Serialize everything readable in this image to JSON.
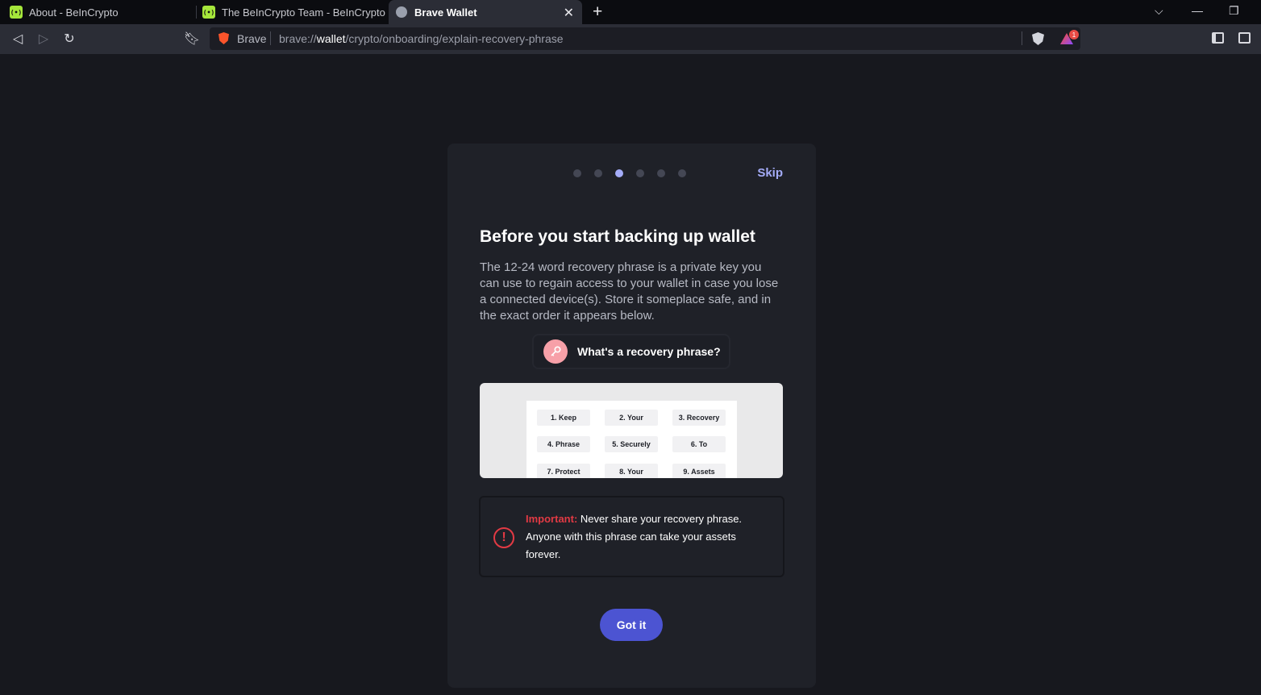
{
  "tabs": [
    {
      "title": "About - BeInCrypto",
      "favicon": "beincrypto-icon"
    },
    {
      "title": "The BeInCrypto Team - BeInCrypto",
      "favicon": "beincrypto-icon"
    },
    {
      "title": "Brave Wallet",
      "favicon": "globe-icon",
      "active": true
    }
  ],
  "toolbar": {
    "omnibox_label": "Brave",
    "url_prefix": "brave://",
    "url_host": "wallet",
    "url_path": "/crypto/onboarding/explain-recovery-phrase",
    "rewards_badge": "1"
  },
  "onboarding": {
    "step_count": 6,
    "current_step": 3,
    "skip_label": "Skip",
    "title": "Before you start backing up wallet",
    "description": "The 12-24 word recovery phrase is a private key you can use to regain access to your wallet in case you lose a connected device(s). Store it someplace safe, and in the exact order it appears below.",
    "whats_label": "What's a recovery phrase?",
    "words": [
      "1. Keep",
      "2. Your",
      "3. Recovery",
      "4. Phrase",
      "5. Securely",
      "6. To",
      "7. Protect",
      "8. Your",
      "9. Assets"
    ],
    "warning_important": "Important:",
    "warning_text": " Never share your recovery phrase. Anyone with this phrase can take your assets forever.",
    "got_it_label": "Got it"
  },
  "colors": {
    "accent": "#4c54d2",
    "active_dot": "#a4acf8",
    "danger": "#e23a44"
  }
}
